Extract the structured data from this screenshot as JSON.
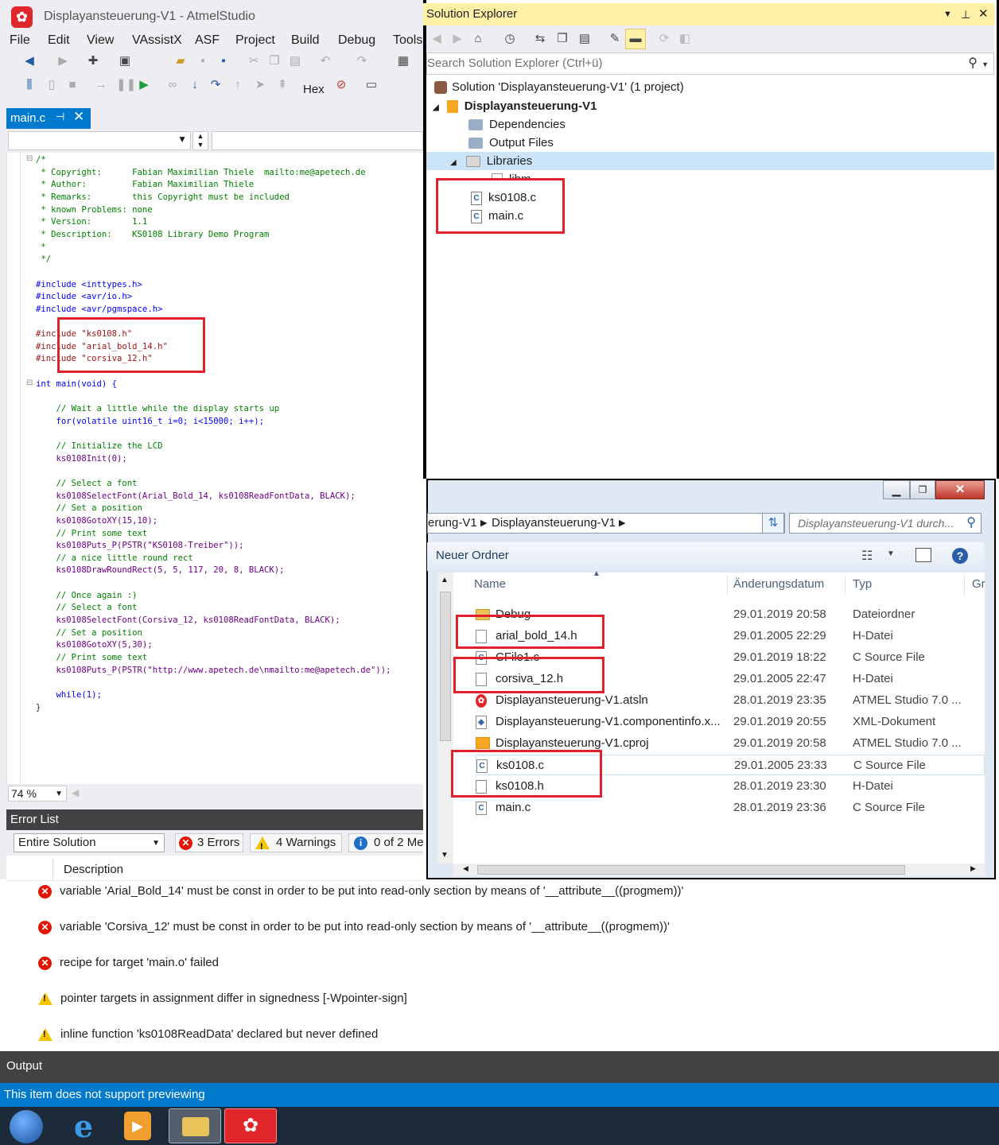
{
  "app": {
    "title": "Displayansteuerung-V1 - AtmelStudio",
    "logo_icon": "atmel-logo-icon",
    "menu": [
      "File",
      "Edit",
      "View",
      "VAssistX",
      "ASF",
      "Project",
      "Build",
      "Debug",
      "Tools"
    ],
    "hex_label": "Hex"
  },
  "editor": {
    "tab_label": "main.c",
    "zoom": "74 %",
    "code": [
      {
        "cls": "c-com",
        "t": "/*"
      },
      {
        "cls": "c-com",
        "t": " * Copyright:      Fabian Maximilian Thiele  mailto:me@apetech.de"
      },
      {
        "cls": "c-com",
        "t": " * Author:         Fabian Maximilian Thiele"
      },
      {
        "cls": "c-com",
        "t": " * Remarks:        this Copyright must be included"
      },
      {
        "cls": "c-com",
        "t": " * known Problems: none"
      },
      {
        "cls": "c-com",
        "t": " * Version:        1.1"
      },
      {
        "cls": "c-com",
        "t": " * Description:    KS0108 Library Demo Program"
      },
      {
        "cls": "c-com",
        "t": " *"
      },
      {
        "cls": "c-com",
        "t": " */"
      },
      {
        "cls": "c-def",
        "t": ""
      },
      {
        "cls": "c-kw",
        "t": "#include <inttypes.h>"
      },
      {
        "cls": "c-kw",
        "t": "#include <avr/io.h>"
      },
      {
        "cls": "c-kw",
        "t": "#include <avr/pgmspace.h>"
      },
      {
        "cls": "c-def",
        "t": ""
      },
      {
        "cls": "c-str",
        "t": "#include \"ks0108.h\""
      },
      {
        "cls": "c-str",
        "t": "#include \"arial_bold_14.h\""
      },
      {
        "cls": "c-str",
        "t": "#include \"corsiva_12.h\""
      },
      {
        "cls": "c-def",
        "t": ""
      },
      {
        "cls": "c-kw",
        "t": "int main(void) {"
      },
      {
        "cls": "c-def",
        "t": ""
      },
      {
        "cls": "c-com",
        "t": "    // Wait a little while the display starts up"
      },
      {
        "cls": "c-kw",
        "t": "    for(volatile uint16_t i=0; i<15000; i++);"
      },
      {
        "cls": "c-def",
        "t": ""
      },
      {
        "cls": "c-com",
        "t": "    // Initialize the LCD"
      },
      {
        "cls": "c-mac",
        "t": "    ks0108Init(0);"
      },
      {
        "cls": "c-def",
        "t": ""
      },
      {
        "cls": "c-com",
        "t": "    // Select a font"
      },
      {
        "cls": "c-mac",
        "t": "    ks0108SelectFont(Arial_Bold_14, ks0108ReadFontData, BLACK);"
      },
      {
        "cls": "c-com",
        "t": "    // Set a position"
      },
      {
        "cls": "c-mac",
        "t": "    ks0108GotoXY(15,10);"
      },
      {
        "cls": "c-com",
        "t": "    // Print some text"
      },
      {
        "cls": "c-mac",
        "t": "    ks0108Puts_P(PSTR(\"KS0108-Treiber\"));"
      },
      {
        "cls": "c-com",
        "t": "    // a nice little round rect"
      },
      {
        "cls": "c-mac",
        "t": "    ks0108DrawRoundRect(5, 5, 117, 20, 8, BLACK);"
      },
      {
        "cls": "c-def",
        "t": ""
      },
      {
        "cls": "c-com",
        "t": "    // Once again :)"
      },
      {
        "cls": "c-com",
        "t": "    // Select a font"
      },
      {
        "cls": "c-mac",
        "t": "    ks0108SelectFont(Corsiva_12, ks0108ReadFontData, BLACK);"
      },
      {
        "cls": "c-com",
        "t": "    // Set a position"
      },
      {
        "cls": "c-mac",
        "t": "    ks0108GotoXY(5,30);"
      },
      {
        "cls": "c-com",
        "t": "    // Print some text"
      },
      {
        "cls": "c-mac",
        "t": "    ks0108Puts_P(PSTR(\"http://www.apetech.de\\nmailto:me@apetech.de\"));"
      },
      {
        "cls": "c-def",
        "t": ""
      },
      {
        "cls": "c-kw",
        "t": "    while(1);"
      },
      {
        "cls": "c-def",
        "t": "}"
      }
    ]
  },
  "error_list": {
    "title": "Error List",
    "scope": "Entire Solution",
    "errors_badge": "3 Errors",
    "warnings_badge": "4 Warnings",
    "messages_badge": "0 of 2 Me",
    "column": "Description",
    "rows": [
      {
        "kind": "error",
        "text": "variable 'Arial_Bold_14' must be const in order to be put into read-only section by means of '__attribute__((progmem))'"
      },
      {
        "kind": "error",
        "text": "variable 'Corsiva_12' must be const in order to be put into read-only section by means of '__attribute__((progmem))'"
      },
      {
        "kind": "error",
        "text": "recipe for target 'main.o' failed"
      },
      {
        "kind": "warning",
        "text": "pointer targets in assignment differ in signedness [-Wpointer-sign]"
      },
      {
        "kind": "warning",
        "text": "inline function 'ks0108ReadData' declared but never defined"
      }
    ]
  },
  "output": {
    "title": "Output"
  },
  "status": {
    "text": "This item does not support previewing"
  },
  "solution_explorer": {
    "title": "Solution Explorer",
    "search_placeholder": "Search Solution Explorer (Ctrl+ü)",
    "solution_label": "Solution 'Displayansteuerung-V1' (1 project)",
    "project_label": "Displayansteuerung-V1",
    "items": [
      {
        "label": "Dependencies",
        "icon": "dependencies-icon"
      },
      {
        "label": "Output Files",
        "icon": "output-files-icon"
      },
      {
        "label": "Libraries",
        "icon": "libraries-icon"
      },
      {
        "label": "libm",
        "icon": "library-icon"
      },
      {
        "label": "ks0108.c",
        "icon": "c-file-icon"
      },
      {
        "label": "main.c",
        "icon": "c-file-icon"
      }
    ]
  },
  "explorer": {
    "breadcrumb_1": "erung-V1",
    "breadcrumb_2": "Displayansteuerung-V1",
    "search_placeholder": "Displayansteuerung-V1 durch...",
    "new_folder": "Neuer Ordner",
    "columns": {
      "name": "Name",
      "date": "Änderungsdatum",
      "type": "Typ",
      "size": "Gr"
    },
    "files": [
      {
        "name": "Debug",
        "date": "29.01.2019 20:58",
        "type": "Dateiordner",
        "icon": "folder"
      },
      {
        "name": "arial_bold_14.h",
        "date": "29.01.2005 22:29",
        "type": "H-Datei",
        "icon": "h"
      },
      {
        "name": "CFile1.c",
        "date": "29.01.2019 18:22",
        "type": "C Source File",
        "icon": "c"
      },
      {
        "name": "corsiva_12.h",
        "date": "29.01.2005 22:47",
        "type": "H-Datei",
        "icon": "h"
      },
      {
        "name": "Displayansteuerung-V1.atsln",
        "date": "28.01.2019 23:35",
        "type": "ATMEL Studio 7.0 ...",
        "icon": "atmel"
      },
      {
        "name": "Displayansteuerung-V1.componentinfo.x...",
        "date": "29.01.2019 20:55",
        "type": "XML-Dokument",
        "icon": "xml"
      },
      {
        "name": "Displayansteuerung-V1.cproj",
        "date": "29.01.2019 20:58",
        "type": "ATMEL Studio 7.0 ...",
        "icon": "proj"
      },
      {
        "name": "ks0108.c",
        "date": "29.01.2005 23:33",
        "type": "C Source File",
        "icon": "c"
      },
      {
        "name": "ks0108.h",
        "date": "28.01.2019 23:30",
        "type": "H-Datei",
        "icon": "h"
      },
      {
        "name": "main.c",
        "date": "28.01.2019 23:36",
        "type": "C Source File",
        "icon": "c"
      }
    ]
  },
  "colors": {
    "accent": "#007acc",
    "highlight_box": "#e0202a",
    "se_title": "#fff1a8"
  }
}
